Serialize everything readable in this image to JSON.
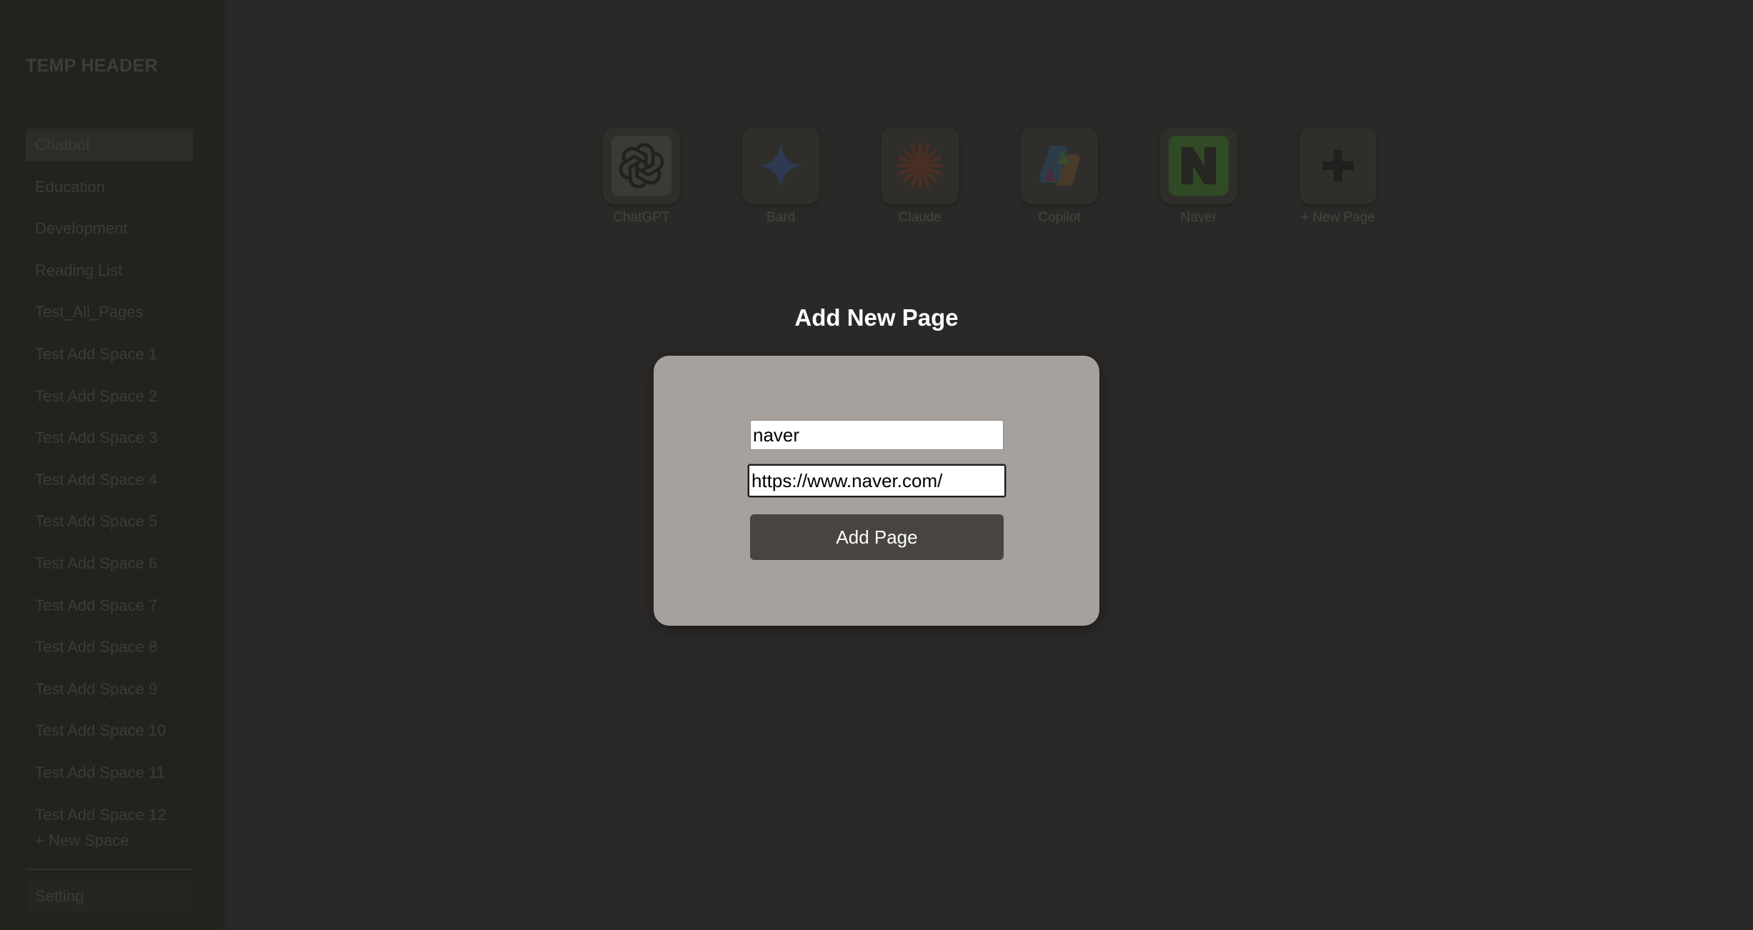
{
  "sidebar": {
    "header": "TEMP HEADER",
    "items": [
      {
        "label": "Chatbot",
        "active": true
      },
      {
        "label": "Education"
      },
      {
        "label": "Development"
      },
      {
        "label": "Reading List"
      },
      {
        "label": "Test_All_Pages"
      },
      {
        "label": "Test Add Space 1"
      },
      {
        "label": "Test Add Space 2"
      },
      {
        "label": "Test Add Space 3"
      },
      {
        "label": "Test Add Space 4"
      },
      {
        "label": "Test Add Space 5"
      },
      {
        "label": "Test Add Space 6"
      },
      {
        "label": "Test Add Space 7"
      },
      {
        "label": "Test Add Space 8"
      },
      {
        "label": "Test Add Space 9"
      },
      {
        "label": "Test Add Space 10"
      },
      {
        "label": "Test Add Space 11"
      },
      {
        "label": "Test Add Space 12"
      }
    ],
    "new_space": "+ New Space",
    "setting": "Setting"
  },
  "tiles": [
    {
      "label": "ChatGPT",
      "icon": "chatgpt-logo-icon"
    },
    {
      "label": "Bard",
      "icon": "bard-star-icon"
    },
    {
      "label": "Claude",
      "icon": "claude-burst-icon"
    },
    {
      "label": "Copilot",
      "icon": "copilot-logo-icon"
    },
    {
      "label": "Naver",
      "icon": "naver-n-icon"
    },
    {
      "label": "+ New Page",
      "icon": "plus-icon"
    }
  ],
  "modal": {
    "title": "Add New Page",
    "name_value": "naver",
    "url_value": "https://www.naver.com/",
    "submit_label": "Add Page"
  },
  "colors": {
    "background": "#2a2927",
    "sidebar": "#22221f",
    "modal": "#a7a19e",
    "button": "#474441",
    "naver_green": "#2db400"
  }
}
